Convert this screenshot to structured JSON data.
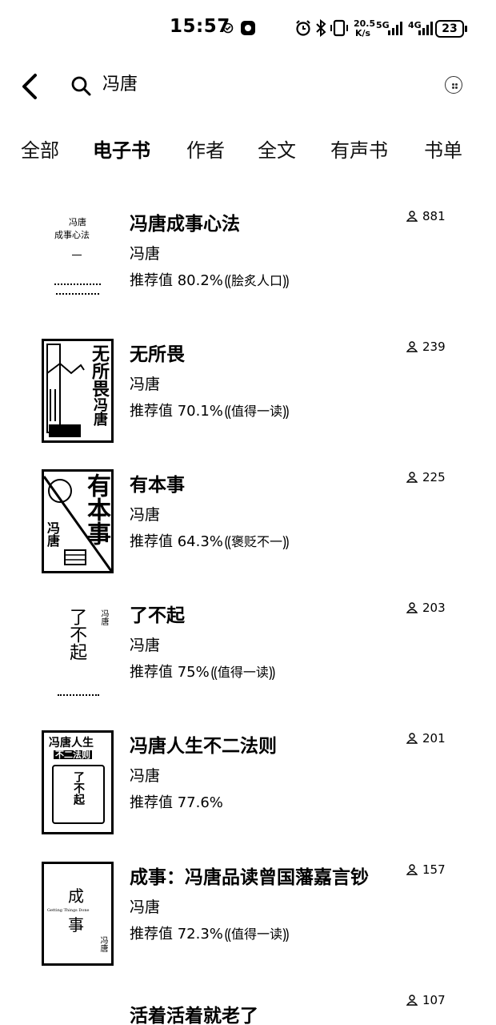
{
  "status_bar": {
    "time": "15:57",
    "net_speed_top": "20.5",
    "net_speed_unit": "K/s",
    "network": "5G",
    "network2": "4G",
    "battery": "23"
  },
  "search": {
    "query": "冯唐"
  },
  "tabs": [
    {
      "label": "全部",
      "active": false
    },
    {
      "label": "电子书",
      "active": true
    },
    {
      "label": "作者",
      "active": false
    },
    {
      "label": "全文",
      "active": false
    },
    {
      "label": "有声书",
      "active": false
    },
    {
      "label": "书单",
      "active": false
    }
  ],
  "results": [
    {
      "title": "冯唐成事心法",
      "author": "冯唐",
      "recommend": "推荐值 80.2%",
      "badge": "脍炙人口",
      "readers": "881",
      "cover_text": {
        "line1": "冯唐",
        "line2": "成事心法"
      }
    },
    {
      "title": "无所畏",
      "author": "冯唐",
      "recommend": "推荐值 70.1%",
      "badge": "值得一读",
      "readers": "239",
      "cover_text": {
        "line1": "无所畏",
        "line2": "冯唐"
      }
    },
    {
      "title": "有本事",
      "author": "冯唐",
      "recommend": "推荐值 64.3%",
      "badge": "褒贬不一",
      "readers": "225",
      "cover_text": {
        "line1": "有本事",
        "line2": "冯唐"
      }
    },
    {
      "title": "了不起",
      "author": "冯唐",
      "recommend": "推荐值 75%",
      "badge": "值得一读",
      "readers": "203",
      "cover_text": {
        "line1": "了不起",
        "line2": "冯唐"
      }
    },
    {
      "title": "冯唐人生不二法则",
      "author": "冯唐",
      "recommend": "推荐值 77.6%",
      "badge": "",
      "readers": "201",
      "cover_text": {
        "line1": "冯唐人生",
        "line2": "不二法则",
        "line3": "了不起"
      }
    },
    {
      "title": "成事：冯唐品读曾国藩嘉言钞",
      "author": "冯唐",
      "recommend": "推荐值 72.3%",
      "badge": "值得一读",
      "readers": "157",
      "cover_text": {
        "line1": "成",
        "line2": "事",
        "line3": "Getting Things Done",
        "line4": "冯唐"
      }
    },
    {
      "title": "活着活着就老了",
      "readers": "107"
    }
  ]
}
